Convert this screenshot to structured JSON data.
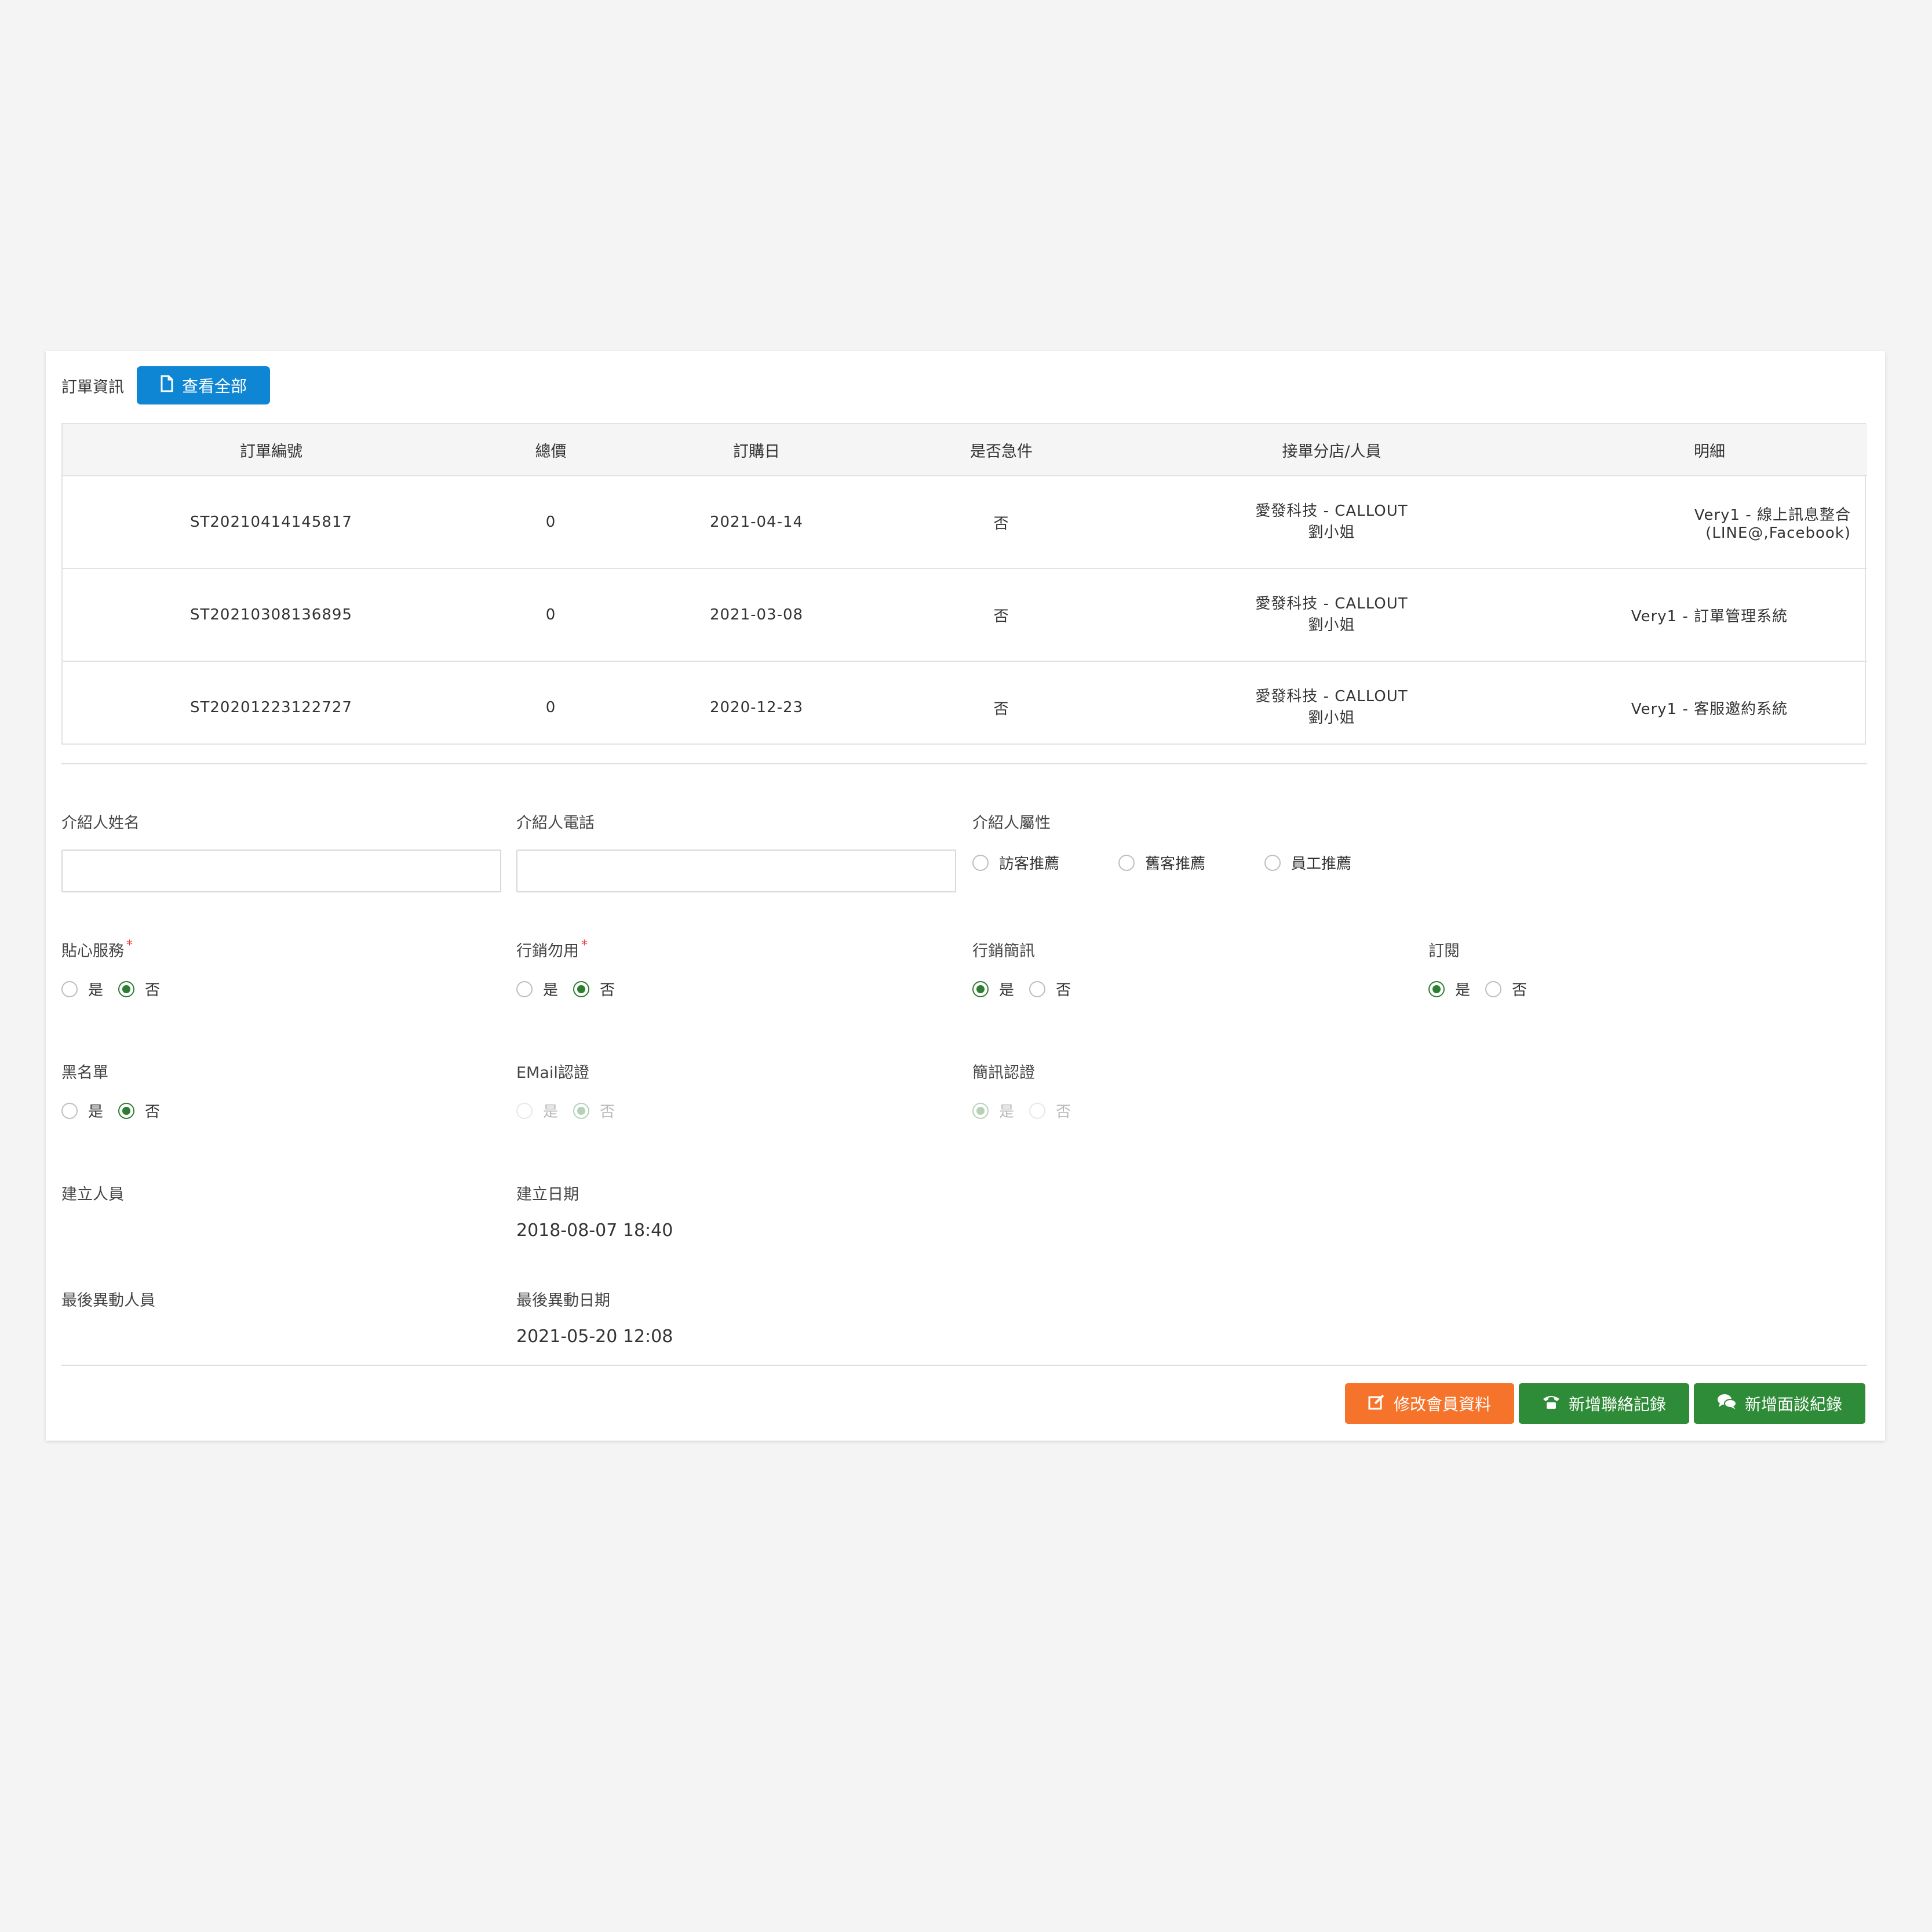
{
  "colors": {
    "primary_blue": "#0e86d4",
    "orange": "#f5732a",
    "green": "#2e8b37",
    "radio_checked": "#2e7d32"
  },
  "order_section": {
    "label": "訂單資訊",
    "view_all_button": "查看全部",
    "view_all_icon": "file-icon",
    "columns": [
      "訂單編號",
      "總價",
      "訂購日",
      "是否急件",
      "接單分店/人員",
      "明細"
    ],
    "rows": [
      {
        "order_no": "ST20210414145817",
        "total": "0",
        "date": "2021-04-14",
        "urgent": "否",
        "branch": "愛發科技 - CALLOUT",
        "staff": "劉小姐",
        "detail": "Very1 - 線上訊息整合(LINE@,Facebook)"
      },
      {
        "order_no": "ST20210308136895",
        "total": "0",
        "date": "2021-03-08",
        "urgent": "否",
        "branch": "愛發科技 - CALLOUT",
        "staff": "劉小姐",
        "detail": "Very1 - 訂單管理系統"
      },
      {
        "order_no": "ST20201223122727",
        "total": "0",
        "date": "2020-12-23",
        "urgent": "否",
        "branch": "愛發科技 - CALLOUT",
        "staff": "劉小姐",
        "detail": "Very1 - 客服邀約系統"
      }
    ]
  },
  "referrer": {
    "name_label": "介紹人姓名",
    "name_value": "",
    "phone_label": "介紹人電話",
    "phone_value": "",
    "type_label": "介紹人屬性",
    "type_options": [
      "訪客推薦",
      "舊客推薦",
      "員工推薦"
    ]
  },
  "settings": {
    "care_service": {
      "label": "貼心服務",
      "required_mark": "*",
      "yes": "是",
      "no": "否",
      "selected": "否"
    },
    "no_marketing": {
      "label": "行銷勿用",
      "required_mark": "*",
      "yes": "是",
      "no": "否",
      "selected": "否"
    },
    "marketing_sms": {
      "label": "行銷簡訊",
      "yes": "是",
      "no": "否",
      "selected": "是"
    },
    "subscribe": {
      "label": "訂閱",
      "yes": "是",
      "no": "否",
      "selected": "是"
    },
    "blacklist": {
      "label": "黑名單",
      "yes": "是",
      "no": "否",
      "selected": "否"
    },
    "email_verify": {
      "label": "EMail認證",
      "yes": "是",
      "no": "否",
      "selected": "否",
      "disabled": true
    },
    "sms_verify": {
      "label": "簡訊認證",
      "yes": "是",
      "no": "否",
      "selected": "是",
      "disabled": true
    }
  },
  "meta": {
    "created_by_label": "建立人員",
    "created_by_value": "",
    "created_date_label": "建立日期",
    "created_date_value": "2018-08-07 18:40",
    "modified_by_label": "最後異動人員",
    "modified_by_value": "",
    "modified_date_label": "最後異動日期",
    "modified_date_value": "2021-05-20 12:08"
  },
  "actions": {
    "edit_member": {
      "label": "修改會員資料",
      "icon": "edit-icon"
    },
    "add_contact": {
      "label": "新增聯絡記錄",
      "icon": "phone-icon"
    },
    "add_interview": {
      "label": "新增面談紀錄",
      "icon": "chat-icon"
    }
  }
}
